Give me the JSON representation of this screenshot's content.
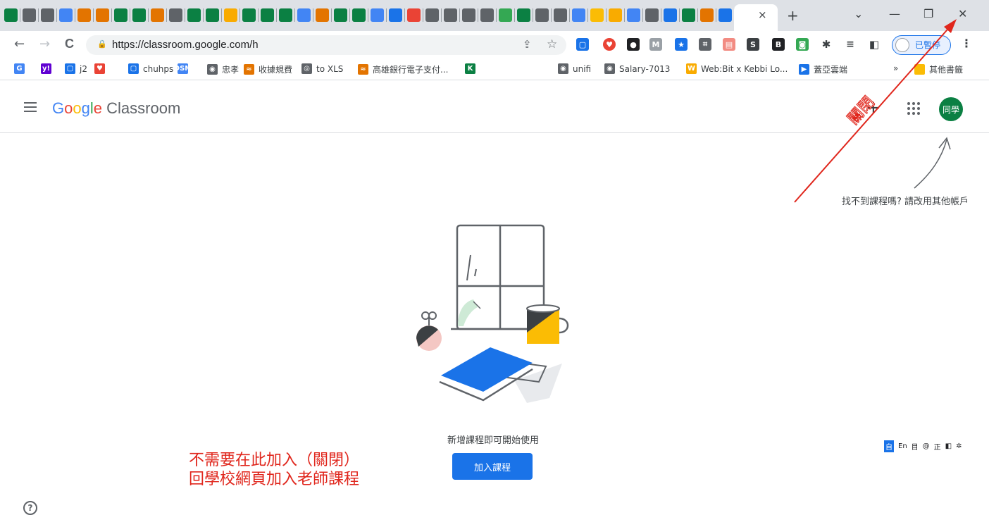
{
  "browser": {
    "tabs": {
      "favicon_colors": [
        "#0b8043",
        "#5f6368",
        "#5f6368",
        "#4285f4",
        "#e37400",
        "#e37400",
        "#0b8043",
        "#0b8043",
        "#e37400",
        "#5f6368",
        "#0b8043",
        "#0b8043",
        "#f9ab00",
        "#0b8043",
        "#0b8043",
        "#0b8043",
        "#4285f4",
        "#e37400",
        "#0b8043",
        "#0b8043",
        "#4285f4",
        "#1a73e8",
        "#ea4335",
        "#5f6368",
        "#5f6368",
        "#5f6368",
        "#5f6368",
        "#34a853",
        "#0b8043",
        "#5f6368",
        "#5f6368",
        "#4285f4",
        "#fbbc05",
        "#f9ab00",
        "#4285f4",
        "#5f6368",
        "#1a73e8",
        "#0b8043",
        "#e37400",
        "#1a73e8",
        "#1a73e8",
        "#5f6368"
      ],
      "active_close": "×",
      "new_tab": "+"
    },
    "window_controls": {
      "chevron": "⌄",
      "minimize": "—",
      "restore": "❐",
      "close": "✕"
    },
    "nav": {
      "back": "←",
      "forward": "→",
      "reload": "C"
    },
    "url": "https://classroom.google.com/h",
    "profile_label": "已暫停",
    "bookmarks": [
      {
        "label": "",
        "icon_color": "#4285f4",
        "glyph": "G"
      },
      {
        "label": "",
        "icon_color": "#6001d2",
        "glyph": "y!"
      },
      {
        "label": "j2",
        "icon_color": "#1a73e8",
        "glyph": "▢"
      },
      {
        "label": "",
        "icon_color": "#ea4335",
        "glyph": "♥"
      },
      {
        "label": "chuhps",
        "icon_color": "#1a73e8",
        "glyph": "▢"
      },
      {
        "label": "",
        "icon_color": "#4285f4",
        "glyph": "DSM"
      },
      {
        "label": "忠孝",
        "icon_color": "#5f6368",
        "glyph": "◉"
      },
      {
        "label": "收據規費",
        "icon_color": "#e37400",
        "glyph": "≈"
      },
      {
        "label": "to XLS",
        "icon_color": "#5f6368",
        "glyph": "◎"
      },
      {
        "label": "高雄銀行電子支付...",
        "icon_color": "#e37400",
        "glyph": "≈"
      },
      {
        "label": "",
        "icon_color": "#0b8043",
        "glyph": "K"
      },
      {
        "label": "unifi",
        "icon_color": "#5f6368",
        "glyph": "◉"
      },
      {
        "label": "Salary-7013",
        "icon_color": "#5f6368",
        "glyph": "◉"
      },
      {
        "label": "Web:Bit x Kebbi Lo...",
        "icon_color": "#f9ab00",
        "glyph": "W"
      },
      {
        "label": "蓋亞雲端",
        "icon_color": "#1a73e8",
        "glyph": "▶"
      }
    ],
    "bookmarks_more": "»",
    "other_bookmarks": "其他書籤"
  },
  "app": {
    "logo_google": [
      "G",
      "o",
      "o",
      "g",
      "l",
      "e"
    ],
    "logo_product": "Classroom",
    "plus": "+",
    "avatar_label": "同學"
  },
  "main": {
    "hint": "找不到課程嗎? 請改用其他帳戶",
    "empty_caption": "新增課程即可開始使用",
    "join_button": "加入課程",
    "help": "?",
    "ime_items": [
      "自",
      "En",
      "目",
      "@",
      "正",
      "◧",
      "✲"
    ]
  },
  "annotations": {
    "close_note": "關閉",
    "instruction_lines": [
      "不需要在此加入（關閉）",
      "回學校網頁加入老師課程"
    ]
  },
  "colors": {
    "accent": "#1a73e8",
    "annotation_red": "#e0261c",
    "avatar_green": "#0b8043"
  }
}
